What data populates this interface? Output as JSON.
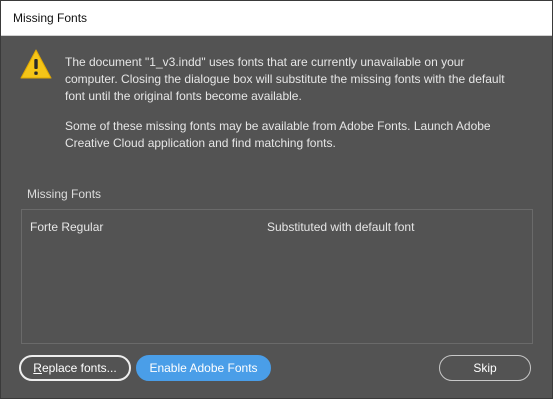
{
  "window": {
    "title": "Missing Fonts"
  },
  "message": {
    "icon": "warning-icon",
    "paragraph1": "The document \"1_v3.indd\" uses fonts that are currently unavailable on your computer. Closing the dialogue box will substitute the missing fonts with the default font until the original fonts become available.",
    "paragraph2": "Some of these missing fonts may be available from Adobe Fonts. Launch Adobe Creative Cloud application and find matching fonts."
  },
  "missing_fonts": {
    "label": "Missing Fonts",
    "rows": [
      {
        "font": "Forte Regular",
        "status": "Substituted with default font"
      }
    ]
  },
  "buttons": {
    "replace_prefix": "R",
    "replace_rest": "eplace fonts...",
    "enable": "Enable Adobe Fonts",
    "skip": "Skip"
  },
  "colors": {
    "background": "#535353",
    "accent": "#4a9ee8",
    "warning": "#f5c518"
  }
}
